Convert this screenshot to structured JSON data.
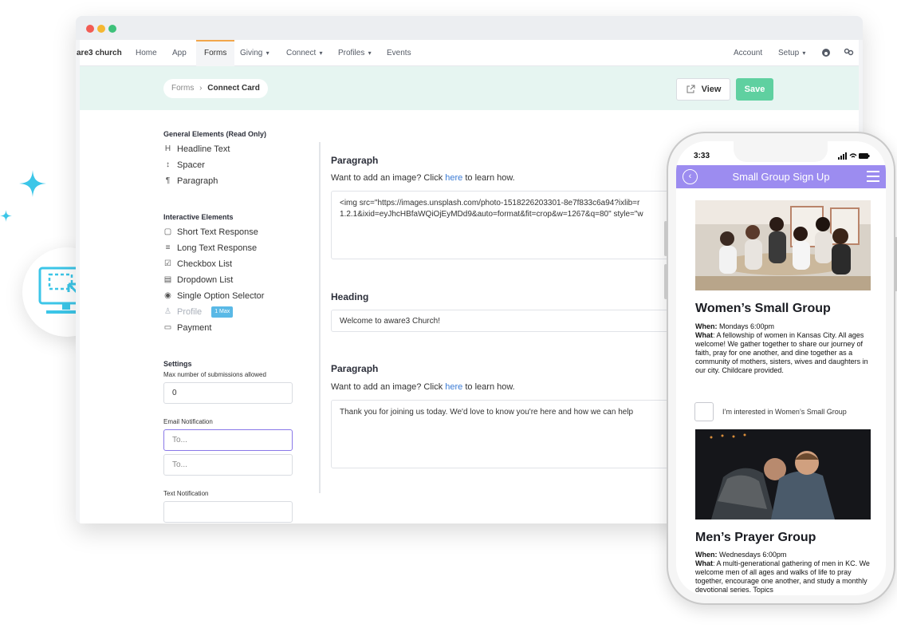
{
  "browser": {
    "nav": {
      "brand": "are3 church",
      "items": [
        "Home",
        "App",
        "Forms",
        "Giving",
        "Connect",
        "Profiles",
        "Events"
      ],
      "right_items": [
        "Account",
        "Setup"
      ]
    },
    "breadcrumb": {
      "parent": "Forms",
      "separator": "›",
      "current": "Connect Card"
    },
    "view_label": "View",
    "save_label": "Save"
  },
  "sidebar": {
    "general_heading": "General Elements (Read Only)",
    "general_items": [
      {
        "icon": "H",
        "label": "Headline Text"
      },
      {
        "icon": "↕",
        "label": "Spacer"
      },
      {
        "icon": "¶",
        "label": "Paragraph"
      }
    ],
    "interactive_heading": "Interactive Elements",
    "interactive_items": [
      {
        "icon": "▢",
        "label": "Short Text Response"
      },
      {
        "icon": "≡",
        "label": "Long Text Response"
      },
      {
        "icon": "☑",
        "label": "Checkbox List"
      },
      {
        "icon": "▤",
        "label": "Dropdown List"
      },
      {
        "icon": "◉",
        "label": "Single Option Selector"
      },
      {
        "icon": "♙",
        "label": "Profile",
        "tag": "1 Max",
        "disabled": true
      },
      {
        "icon": "▭",
        "label": "Payment"
      }
    ],
    "settings_heading": "Settings",
    "max_submissions_label": "Max number of submissions allowed",
    "max_submissions_value": "0",
    "email_label": "Email Notification",
    "email_placeholder_1": "To...",
    "email_placeholder_2": "To...",
    "text_label": "Text Notification"
  },
  "editor": {
    "block1": {
      "title": "Paragraph",
      "help_prefix": "Want to add an image? Click ",
      "help_link": "here",
      "help_suffix": " to learn how.",
      "content_line1": "<img src=\"https://images.unsplash.com/photo-1518226203301-8e7f833c6a94?ixlib=r",
      "content_line2": "1.2.1&ixid=eyJhcHBfaWQiOjEyMDd9&auto=format&fit=crop&w=1267&q=80\" style=\"w"
    },
    "block2": {
      "title": "Heading",
      "value": "Welcome to aware3 Church!"
    },
    "block3": {
      "title": "Paragraph",
      "help_prefix": "Want to add an image? Click ",
      "help_link": "here",
      "help_suffix": " to learn how.",
      "content": "Thank you for joining us today. We'd love to know you're here and how we can help"
    }
  },
  "phone": {
    "time": "3:33",
    "header_title": "Small Group Sign Up",
    "group1": {
      "title": "Women’s Small Group",
      "when_label": "When:",
      "when": " Mondays 6:00pm",
      "what_label": "What",
      "what": ": A fellowship of women in Kansas City. All ages welcome! We gather together to share our journey of faith, pray for one another, and dine together as a community of mothers, sisters, wives and daughters in our city. Childcare provided.",
      "checkbox_label": "I’m interested in Women’s Small Group"
    },
    "group2": {
      "title": "Men’s Prayer Group",
      "when_label": "When:",
      "when": " Wednesdays 6:00pm",
      "what_label": "What",
      "what": ": A multi-generational gathering of men in KC. We welcome men of all ages and walks of life to pray together, encourage one another, and study a monthly devotional series. Topics"
    }
  },
  "colors": {
    "accent_green": "#5fd0a0",
    "phone_header": "#9c8cf0",
    "link_blue": "#3b7bd4",
    "sparkle": "#3cc6e8"
  }
}
